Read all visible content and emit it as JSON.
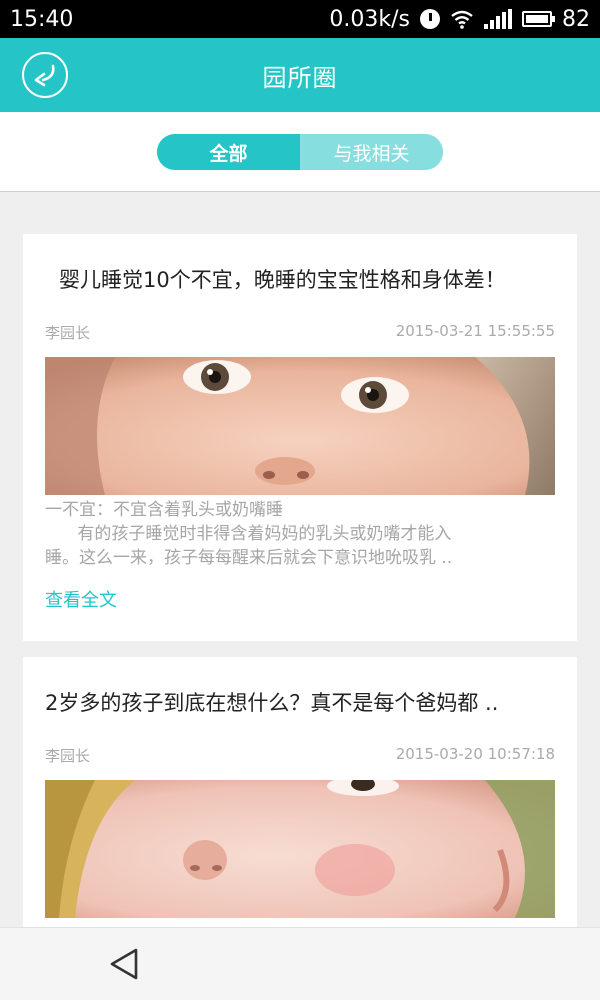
{
  "status_bar": {
    "time": "15:40",
    "network_speed": "0.03k/s",
    "battery": "82",
    "icons": [
      "alarm-icon",
      "wifi-icon",
      "signal-icon",
      "battery-icon"
    ]
  },
  "header": {
    "title": "园所圈",
    "back_icon": "back-arrow-icon"
  },
  "tabs": [
    {
      "label": "全部",
      "active": true
    },
    {
      "label": "与我相关",
      "active": false
    }
  ],
  "posts": [
    {
      "title": "婴儿睡觉10个不宜，晚睡的宝宝性格和身体差！",
      "author": "李园长",
      "time": "2015-03-21 15:55:55",
      "excerpt_lines": [
        "一不宜：不宜含着乳头或奶嘴睡",
        "      有的孩子睡觉时非得含着妈妈的乳头或奶嘴才能入",
        "睡。这么一来，孩子每每醒来后就会下意识地吮吸乳 .."
      ],
      "read_more": "查看全文"
    },
    {
      "title": "2岁多的孩子到底在想什么？真不是每个爸妈都 ..",
      "author": "李园长",
      "time": "2015-03-20 10:57:18"
    }
  ],
  "colors": {
    "accent": "#25c5c7",
    "accent_light": "#86dedf",
    "background": "#efefef"
  }
}
